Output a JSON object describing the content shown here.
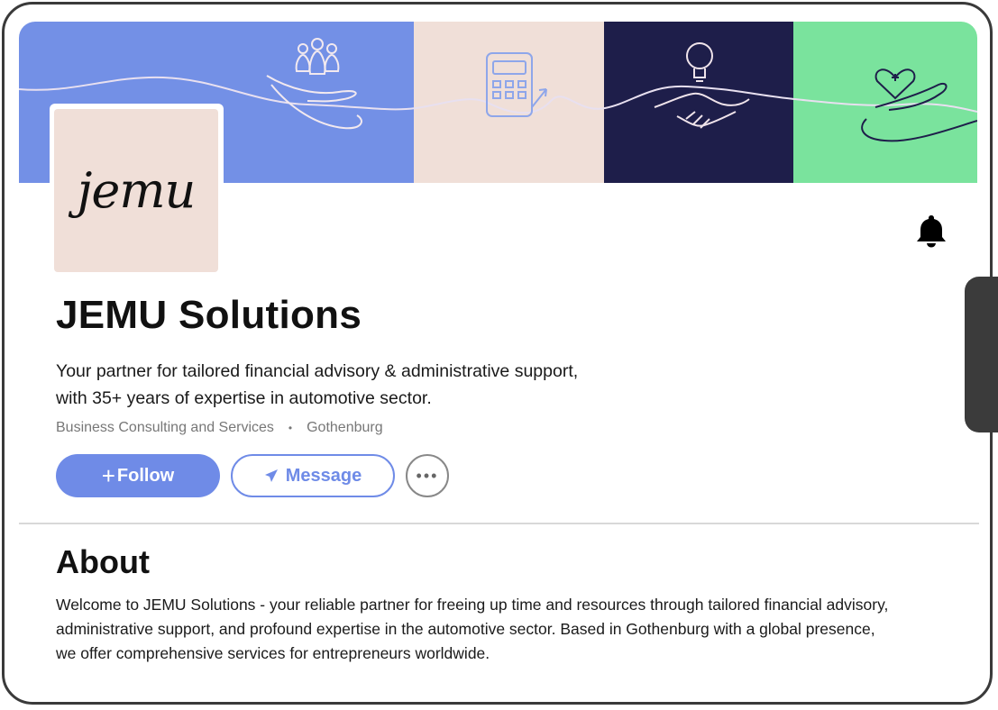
{
  "company": {
    "logo_text": "jemu",
    "name": "JEMU Solutions",
    "tagline_line1": "Your partner for tailored financial advisory & administrative support,",
    "tagline_line2": "with 35+ years of expertise in automotive sector.",
    "industry": "Business Consulting and Services",
    "separator": "•",
    "location": "Gothenburg"
  },
  "actions": {
    "follow_plus": "+",
    "follow_label": "Follow",
    "message_label": "Message",
    "more_label": "•••"
  },
  "about": {
    "title": "About",
    "text": "Welcome to JEMU Solutions - your reliable partner for freeing up time and resources through tailored financial advisory, administrative support, and profound expertise in the automotive sector. Based in Gothenburg with a global presence, we offer comprehensive services for entrepreneurs worldwide."
  },
  "icons": {
    "bell": "bell-icon",
    "message": "paper-plane-icon",
    "more": "ellipsis-icon"
  },
  "colors": {
    "accent": "#6f8be7",
    "banner_blue": "#7390e6",
    "banner_pink": "#f0dfd8",
    "banner_navy": "#1e1e4a",
    "banner_green": "#7ae39d"
  }
}
